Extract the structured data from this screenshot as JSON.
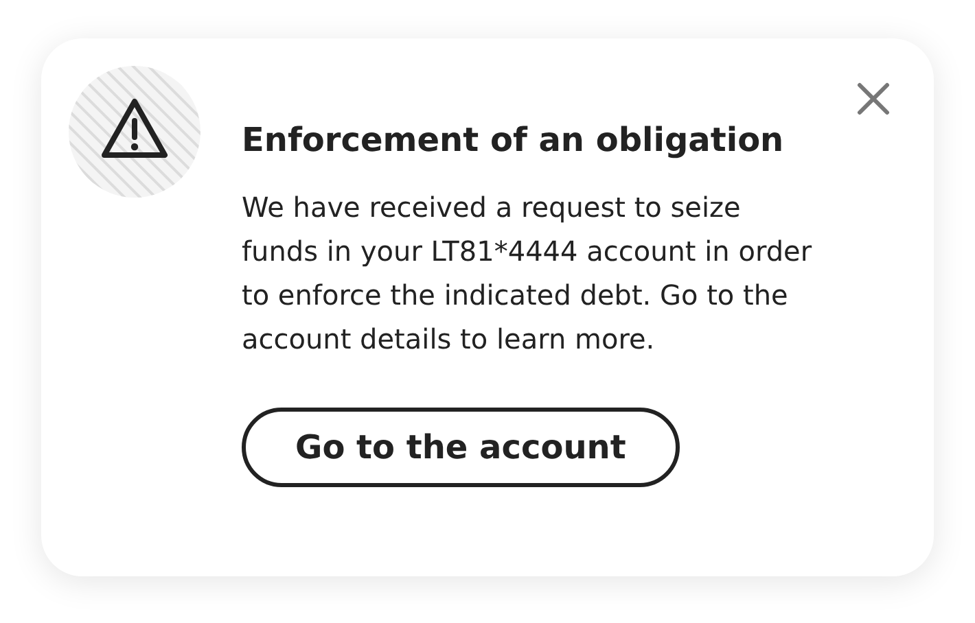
{
  "dialog": {
    "title": "Enforcement of an obligation",
    "message": "We have received a request to seize funds in your LT81*4444 account in order to enforce the indicated debt. Go to the account details to learn more.",
    "button": "Go to the account"
  }
}
